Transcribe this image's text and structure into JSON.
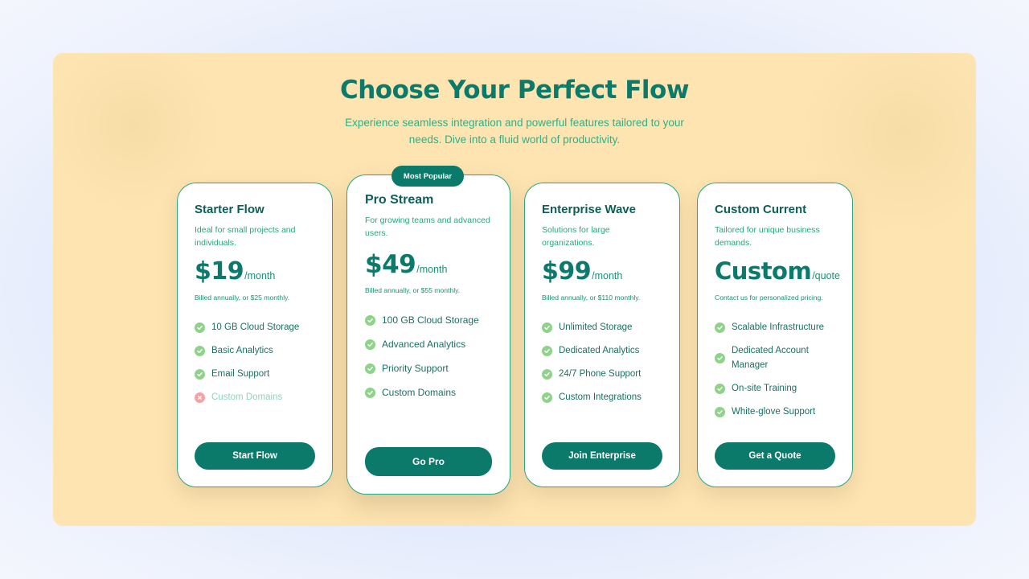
{
  "header": {
    "title": "Choose Your Perfect Flow",
    "subtitle": "Experience seamless integration and powerful features tailored to your needs. Dive into a fluid world of productivity."
  },
  "colors": {
    "brand": "#0b7a6a",
    "panel_bg": "#fde4b1",
    "check": "#8fd28a",
    "cross": "#f2a3a3"
  },
  "plans": [
    {
      "name": "Starter Flow",
      "description": "Ideal for small projects and individuals.",
      "price": "$19",
      "period": "/month",
      "billing": "Billed annually, or $25 monthly.",
      "features": [
        {
          "text": "10 GB Cloud Storage",
          "included": true,
          "icon": "check-icon"
        },
        {
          "text": "Basic Analytics",
          "included": true,
          "icon": "check-icon"
        },
        {
          "text": "Email Support",
          "included": true,
          "icon": "check-icon"
        },
        {
          "text": "Custom Domains",
          "included": false,
          "icon": "cross-icon"
        }
      ],
      "cta": "Start Flow"
    },
    {
      "badge": "Most Popular",
      "name": "Pro Stream",
      "description": "For growing teams and advanced users.",
      "price": "$49",
      "period": "/month",
      "billing": "Billed annually, or $55 monthly.",
      "features": [
        {
          "text": "100 GB Cloud Storage",
          "included": true,
          "icon": "check-icon"
        },
        {
          "text": "Advanced Analytics",
          "included": true,
          "icon": "check-icon"
        },
        {
          "text": "Priority Support",
          "included": true,
          "icon": "check-icon"
        },
        {
          "text": "Custom Domains",
          "included": true,
          "icon": "check-icon"
        }
      ],
      "cta": "Go Pro"
    },
    {
      "name": "Enterprise Wave",
      "description": "Solutions for large organizations.",
      "price": "$99",
      "period": "/month",
      "billing": "Billed annually, or $110 monthly.",
      "features": [
        {
          "text": "Unlimited Storage",
          "included": true,
          "icon": "check-icon"
        },
        {
          "text": "Dedicated Analytics",
          "included": true,
          "icon": "check-icon"
        },
        {
          "text": "24/7 Phone Support",
          "included": true,
          "icon": "check-icon"
        },
        {
          "text": "Custom Integrations",
          "included": true,
          "icon": "check-icon"
        }
      ],
      "cta": "Join Enterprise"
    },
    {
      "name": "Custom Current",
      "description": "Tailored for unique business demands.",
      "price": "Custom",
      "period": "/quote",
      "billing": "Contact us for personalized pricing.",
      "features": [
        {
          "text": "Scalable Infrastructure",
          "included": true,
          "icon": "check-icon"
        },
        {
          "text": "Dedicated Account Manager",
          "included": true,
          "icon": "check-icon"
        },
        {
          "text": "On-site Training",
          "included": true,
          "icon": "check-icon"
        },
        {
          "text": "White-glove Support",
          "included": true,
          "icon": "check-icon"
        }
      ],
      "cta": "Get a Quote"
    }
  ]
}
